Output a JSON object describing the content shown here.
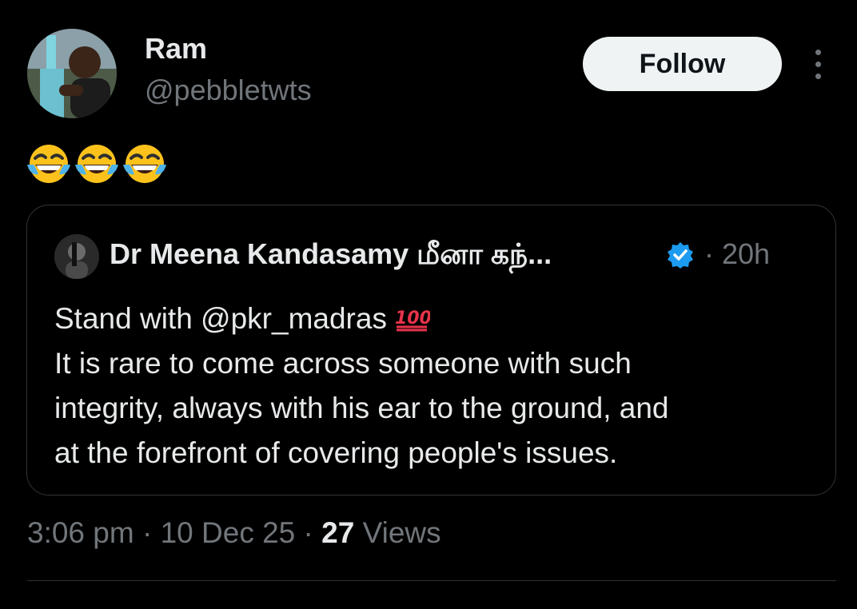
{
  "author": {
    "display_name": "Ram",
    "handle": "@pebbletwts"
  },
  "follow_label": "Follow",
  "tweet": {
    "emoji_icons": [
      "face-with-tears-of-joy-icon",
      "face-with-tears-of-joy-icon",
      "face-with-tears-of-joy-icon"
    ]
  },
  "quoted": {
    "display_name": "Dr Meena Kandasamy மீனா கந்...",
    "verified": true,
    "separator": "·",
    "time": "20h",
    "lines": [
      "Stand with @pkr_madras",
      "It is rare to come across someone with such",
      "integrity,  always with his ear to the ground, and",
      "at the forefront of covering people's issues."
    ],
    "trailing_icon": "hundred-points-icon"
  },
  "meta": {
    "time": "3:06 pm",
    "separator": "·",
    "date": "10 Dec 25",
    "views_count": "27",
    "views_label": "Views"
  },
  "colors": {
    "background": "#000000",
    "primary_text": "#e7e9ea",
    "secondary_text": "#71767b",
    "border": "#2f3336",
    "verified": "#1d9bf0",
    "follow_bg": "#eff3f4"
  }
}
